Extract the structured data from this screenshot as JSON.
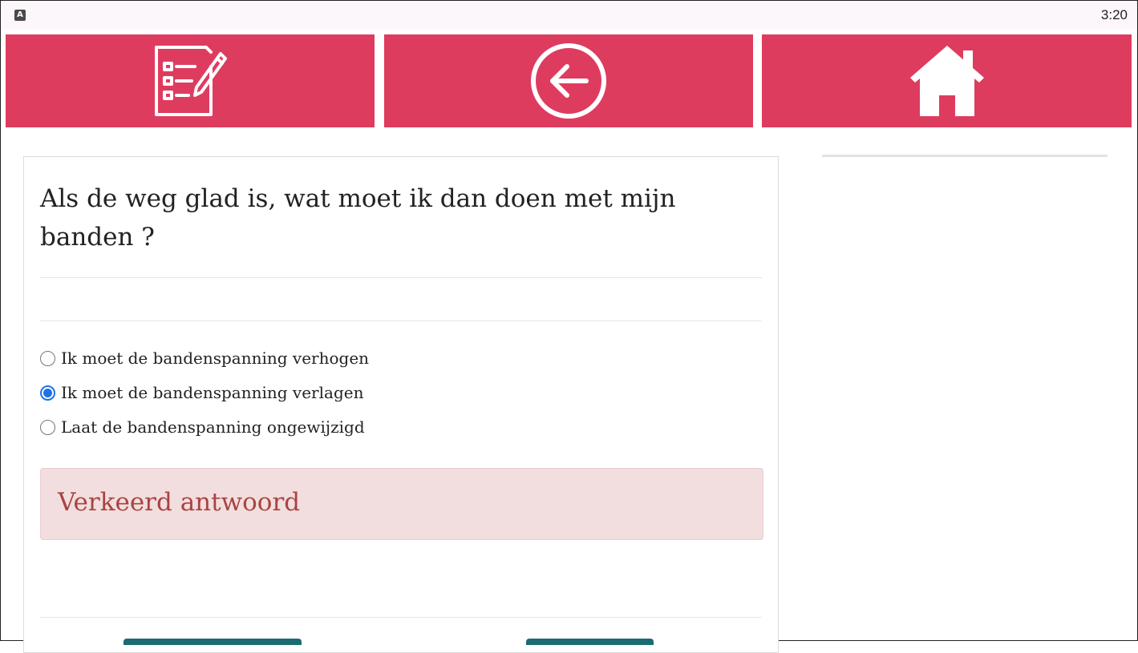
{
  "status_bar": {
    "app_icon_letter": "A",
    "time": "3:20"
  },
  "nav": {
    "quiz_icon": "checklist-pencil-icon",
    "back_icon": "circle-arrow-left-icon",
    "home_icon": "home-icon",
    "color": "#de3c5f"
  },
  "question": {
    "text": "Als de weg glad is, wat moet ik dan doen met mijn banden ?"
  },
  "options": [
    {
      "label": "Ik moet de bandenspanning verhogen",
      "checked": false
    },
    {
      "label": "Ik moet de bandenspanning verlagen",
      "checked": true
    },
    {
      "label": "Laat de bandenspanning ongewijzigd",
      "checked": false
    }
  ],
  "feedback": {
    "text": "Verkeerd antwoord",
    "color": "#a94442",
    "background": "#f2dede"
  }
}
